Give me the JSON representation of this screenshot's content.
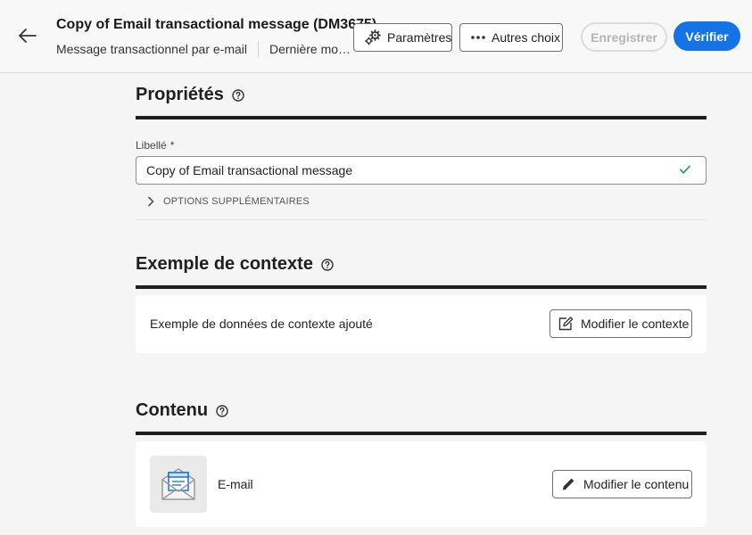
{
  "header": {
    "title": "Copy of Email transactional message (DM3675)",
    "channel": "Message transactionnel par e-mail",
    "last_modified": "Dernière modification",
    "params_label": "Paramètres",
    "more_label": "Autres choix",
    "save_label": "Enregistrer",
    "verify_label": "Vérifier"
  },
  "properties": {
    "title": "Propriétés",
    "label_field": "Libellé",
    "required_mark": "*",
    "label_value": "Copy of Email transactional message",
    "more_options": "OPTIONS SUPPLÉMENTAIRES"
  },
  "context": {
    "title": "Exemple de contexte",
    "text": "Exemple de données de contexte ajouté",
    "edit_label": "Modifier le contexte"
  },
  "content": {
    "title": "Contenu",
    "channel_label": "E-mail",
    "edit_label": "Modifier le contenu"
  },
  "colors": {
    "accent": "#1473e6",
    "success": "#2d9d78"
  }
}
